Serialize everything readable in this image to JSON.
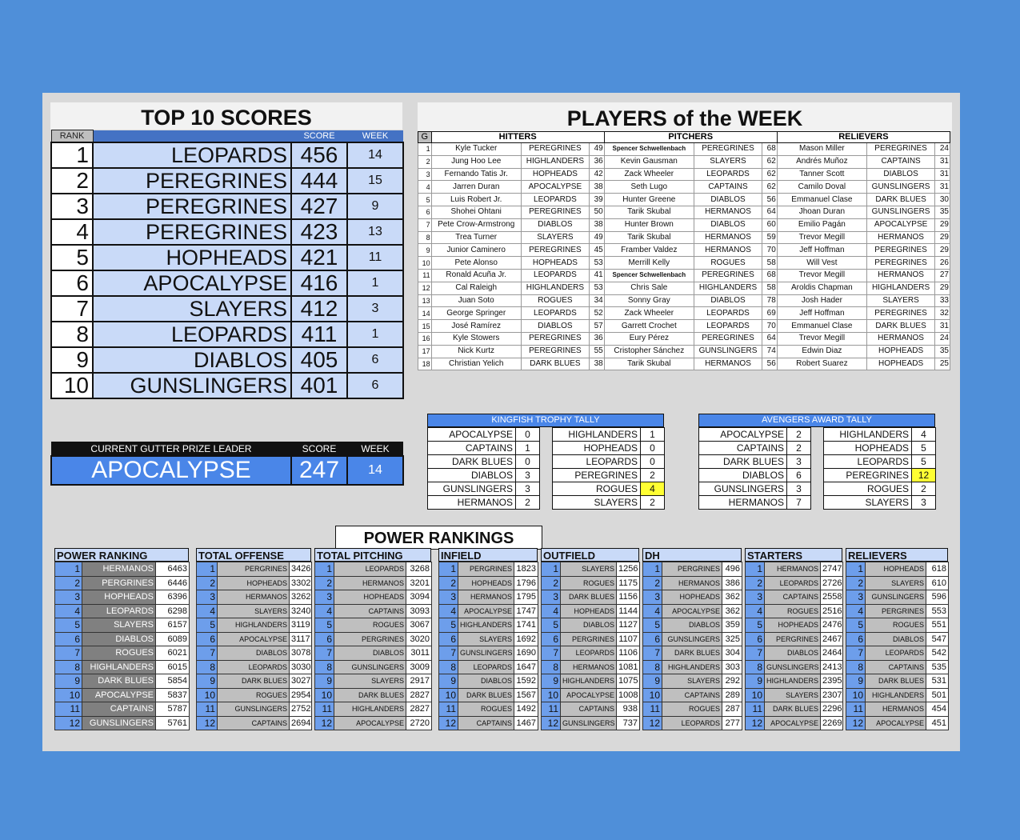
{
  "top10": {
    "title": "TOP 10 SCORES",
    "headers": {
      "rank": "RANK",
      "score": "SCORE",
      "week": "WEEK"
    },
    "rows": [
      {
        "rank": "1",
        "team": "LEOPARDS",
        "score": "456",
        "week": "14"
      },
      {
        "rank": "2",
        "team": "PEREGRINES",
        "score": "444",
        "week": "15"
      },
      {
        "rank": "3",
        "team": "PEREGRINES",
        "score": "427",
        "week": "9"
      },
      {
        "rank": "4",
        "team": "PEREGRINES",
        "score": "423",
        "week": "13"
      },
      {
        "rank": "5",
        "team": "HOPHEADS",
        "score": "421",
        "week": "11"
      },
      {
        "rank": "6",
        "team": "APOCALYPSE",
        "score": "416",
        "week": "1"
      },
      {
        "rank": "7",
        "team": "SLAYERS",
        "score": "412",
        "week": "3"
      },
      {
        "rank": "8",
        "team": "LEOPARDS",
        "score": "411",
        "week": "1"
      },
      {
        "rank": "9",
        "team": "DIABLOS",
        "score": "405",
        "week": "6"
      },
      {
        "rank": "10",
        "team": "GUNSLINGERS",
        "score": "401",
        "week": "6"
      }
    ]
  },
  "gutter": {
    "header": "CURRENT GUTTER PRIZE LEADER",
    "score_header": "SCORE",
    "week_header": "WEEK",
    "team": "APOCALYPSE",
    "score": "247",
    "week": "14"
  },
  "potw": {
    "title": "PLAYERS of the WEEK",
    "headers": {
      "g": "G",
      "hitters": "HITTERS",
      "pitchers": "PITCHERS",
      "relievers": "RELIEVERS"
    },
    "rows": [
      {
        "g": "1",
        "h": "Kyle Tucker",
        "ht": "PEREGRINES",
        "hs": "49",
        "p": "Spencer Schwellenbach",
        "pt": "PEREGRINES",
        "ps": "68",
        "r": "Mason Miller",
        "rt": "PEREGRINES",
        "rs": "24"
      },
      {
        "g": "2",
        "h": "Jung Hoo Lee",
        "ht": "HIGHLANDERS",
        "hs": "36",
        "p": "Kevin Gausman",
        "pt": "SLAYERS",
        "ps": "62",
        "r": "Andrés Muñoz",
        "rt": "CAPTAINS",
        "rs": "31"
      },
      {
        "g": "3",
        "h": "Fernando Tatis Jr.",
        "ht": "HOPHEADS",
        "hs": "42",
        "p": "Zack Wheeler",
        "pt": "LEOPARDS",
        "ps": "62",
        "r": "Tanner Scott",
        "rt": "DIABLOS",
        "rs": "31"
      },
      {
        "g": "4",
        "h": "Jarren Duran",
        "ht": "APOCALYPSE",
        "hs": "38",
        "p": "Seth Lugo",
        "pt": "CAPTAINS",
        "ps": "62",
        "r": "Camilo Doval",
        "rt": "GUNSLINGERS",
        "rs": "31"
      },
      {
        "g": "5",
        "h": "Luis Robert Jr.",
        "ht": "LEOPARDS",
        "hs": "39",
        "p": "Hunter Greene",
        "pt": "DIABLOS",
        "ps": "56",
        "r": "Emmanuel Clase",
        "rt": "DARK BLUES",
        "rs": "30"
      },
      {
        "g": "6",
        "h": "Shohei Ohtani",
        "ht": "PEREGRINES",
        "hs": "50",
        "p": "Tarik Skubal",
        "pt": "HERMANOS",
        "ps": "64",
        "r": "Jhoan Duran",
        "rt": "GUNSLINGERS",
        "rs": "35"
      },
      {
        "g": "7",
        "h": "Pete Crow-Armstrong",
        "ht": "DIABLOS",
        "hs": "38",
        "p": "Hunter Brown",
        "pt": "DIABLOS",
        "ps": "60",
        "r": "Emilio Pagán",
        "rt": "APOCALYPSE",
        "rs": "29"
      },
      {
        "g": "8",
        "h": "Trea Turner",
        "ht": "SLAYERS",
        "hs": "49",
        "p": "Tarik Skubal",
        "pt": "HERMANOS",
        "ps": "59",
        "r": "Trevor Megill",
        "rt": "HERMANOS",
        "rs": "29"
      },
      {
        "g": "9",
        "h": "Junior Caminero",
        "ht": "PEREGRINES",
        "hs": "45",
        "p": "Framber Valdez",
        "pt": "HERMANOS",
        "ps": "70",
        "r": "Jeff Hoffman",
        "rt": "PEREGRINES",
        "rs": "29"
      },
      {
        "g": "10",
        "h": "Pete Alonso",
        "ht": "HOPHEADS",
        "hs": "53",
        "p": "Merrill Kelly",
        "pt": "ROGUES",
        "ps": "58",
        "r": "Will Vest",
        "rt": "PEREGRINES",
        "rs": "26"
      },
      {
        "g": "11",
        "h": "Ronald Acuña Jr.",
        "ht": "LEOPARDS",
        "hs": "41",
        "p": "Spencer Schwellenbach",
        "pt": "PEREGRINES",
        "ps": "68",
        "r": "Trevor Megill",
        "rt": "HERMANOS",
        "rs": "27"
      },
      {
        "g": "12",
        "h": "Cal Raleigh",
        "ht": "HIGHLANDERS",
        "hs": "53",
        "p": "Chris Sale",
        "pt": "HIGHLANDERS",
        "ps": "58",
        "r": "Aroldis Chapman",
        "rt": "HIGHLANDERS",
        "rs": "29"
      },
      {
        "g": "13",
        "h": "Juan Soto",
        "ht": "ROGUES",
        "hs": "34",
        "p": "Sonny Gray",
        "pt": "DIABLOS",
        "ps": "78",
        "r": "Josh Hader",
        "rt": "SLAYERS",
        "rs": "33"
      },
      {
        "g": "14",
        "h": "George Springer",
        "ht": "LEOPARDS",
        "hs": "52",
        "p": "Zack Wheeler",
        "pt": "LEOPARDS",
        "ps": "69",
        "r": "Jeff Hoffman",
        "rt": "PEREGRINES",
        "rs": "32"
      },
      {
        "g": "15",
        "h": "José Ramírez",
        "ht": "DIABLOS",
        "hs": "57",
        "p": "Garrett Crochet",
        "pt": "LEOPARDS",
        "ps": "70",
        "r": "Emmanuel Clase",
        "rt": "DARK BLUES",
        "rs": "31"
      },
      {
        "g": "16",
        "h": "Kyle Stowers",
        "ht": "PEREGRINES",
        "hs": "36",
        "p": "Eury Pérez",
        "pt": "PEREGRINES",
        "ps": "64",
        "r": "Trevor Megill",
        "rt": "HERMANOS",
        "rs": "24"
      },
      {
        "g": "17",
        "h": "Nick Kurtz",
        "ht": "PEREGRINES",
        "hs": "55",
        "p": "Cristopher Sánchez",
        "pt": "GUNSLINGERS",
        "ps": "74",
        "r": "Edwin Diaz",
        "rt": "HOPHEADS",
        "rs": "35"
      },
      {
        "g": "18",
        "h": "Christian Yelich",
        "ht": "DARK BLUES",
        "hs": "38",
        "p": "Tarik Skubal",
        "pt": "HERMANOS",
        "ps": "56",
        "r": "Robert Suarez",
        "rt": "HOPHEADS",
        "rs": "25"
      }
    ]
  },
  "kingfish": {
    "title": "KINGFISH TROPHY TALLY",
    "left": [
      {
        "team": "APOCALYPSE",
        "v": "0"
      },
      {
        "team": "CAPTAINS",
        "v": "1"
      },
      {
        "team": "DARK BLUES",
        "v": "0"
      },
      {
        "team": "DIABLOS",
        "v": "3"
      },
      {
        "team": "GUNSLINGERS",
        "v": "3"
      },
      {
        "team": "HERMANOS",
        "v": "2"
      }
    ],
    "right": [
      {
        "team": "HIGHLANDERS",
        "v": "1"
      },
      {
        "team": "HOPHEADS",
        "v": "0"
      },
      {
        "team": "LEOPARDS",
        "v": "0"
      },
      {
        "team": "PEREGRINES",
        "v": "2"
      },
      {
        "team": "ROGUES",
        "v": "4",
        "hi": true
      },
      {
        "team": "SLAYERS",
        "v": "2"
      }
    ]
  },
  "avengers": {
    "title": "AVENGERS AWARD TALLY",
    "left": [
      {
        "team": "APOCALYPSE",
        "v": "2"
      },
      {
        "team": "CAPTAINS",
        "v": "2"
      },
      {
        "team": "DARK BLUES",
        "v": "3"
      },
      {
        "team": "DIABLOS",
        "v": "6"
      },
      {
        "team": "GUNSLINGERS",
        "v": "3"
      },
      {
        "team": "HERMANOS",
        "v": "7"
      }
    ],
    "right": [
      {
        "team": "HIGHLANDERS",
        "v": "4"
      },
      {
        "team": "HOPHEADS",
        "v": "5"
      },
      {
        "team": "LEOPARDS",
        "v": "5"
      },
      {
        "team": "PEREGRINES",
        "v": "12",
        "hi": true
      },
      {
        "team": "ROGUES",
        "v": "2"
      },
      {
        "team": "SLAYERS",
        "v": "3"
      }
    ]
  },
  "power": {
    "title": "POWER RANKINGS",
    "tables": [
      {
        "header": "POWER RANKING",
        "rows": [
          [
            "1",
            "HERMANOS",
            "6463"
          ],
          [
            "2",
            "PERGRINES",
            "6446"
          ],
          [
            "3",
            "HOPHEADS",
            "6396"
          ],
          [
            "4",
            "LEOPARDS",
            "6298"
          ],
          [
            "5",
            "SLAYERS",
            "6157"
          ],
          [
            "6",
            "DIABLOS",
            "6089"
          ],
          [
            "7",
            "ROGUES",
            "6021"
          ],
          [
            "8",
            "HIGHLANDERS",
            "6015"
          ],
          [
            "9",
            "DARK BLUES",
            "5854"
          ],
          [
            "10",
            "APOCALYPSE",
            "5837"
          ],
          [
            "11",
            "CAPTAINS",
            "5787"
          ],
          [
            "12",
            "GUNSLINGERS",
            "5761"
          ]
        ]
      },
      {
        "header": "TOTAL OFFENSE",
        "rows": [
          [
            "1",
            "PERGRINES",
            "3426"
          ],
          [
            "2",
            "HOPHEADS",
            "3302"
          ],
          [
            "3",
            "HERMANOS",
            "3262"
          ],
          [
            "4",
            "SLAYERS",
            "3240"
          ],
          [
            "5",
            "HIGHLANDERS",
            "3119"
          ],
          [
            "6",
            "APOCALYPSE",
            "3117"
          ],
          [
            "7",
            "DIABLOS",
            "3078"
          ],
          [
            "8",
            "LEOPARDS",
            "3030"
          ],
          [
            "9",
            "DARK BLUES",
            "3027"
          ],
          [
            "10",
            "ROGUES",
            "2954"
          ],
          [
            "11",
            "GUNSLINGERS",
            "2752"
          ],
          [
            "12",
            "CAPTAINS",
            "2694"
          ]
        ]
      },
      {
        "header": "TOTAL PITCHING",
        "rows": [
          [
            "1",
            "LEOPARDS",
            "3268"
          ],
          [
            "2",
            "HERMANOS",
            "3201"
          ],
          [
            "3",
            "HOPHEADS",
            "3094"
          ],
          [
            "4",
            "CAPTAINS",
            "3093"
          ],
          [
            "5",
            "ROGUES",
            "3067"
          ],
          [
            "6",
            "PERGRINES",
            "3020"
          ],
          [
            "7",
            "DIABLOS",
            "3011"
          ],
          [
            "8",
            "GUNSLINGERS",
            "3009"
          ],
          [
            "9",
            "SLAYERS",
            "2917"
          ],
          [
            "10",
            "DARK BLUES",
            "2827"
          ],
          [
            "11",
            "HIGHLANDERS",
            "2827"
          ],
          [
            "12",
            "APOCALYPSE",
            "2720"
          ]
        ]
      },
      {
        "header": "INFIELD",
        "rows": [
          [
            "1",
            "PERGRINES",
            "1823"
          ],
          [
            "2",
            "HOPHEADS",
            "1796"
          ],
          [
            "3",
            "HERMANOS",
            "1795"
          ],
          [
            "4",
            "APOCALYPSE",
            "1747"
          ],
          [
            "5",
            "HIGHLANDERS",
            "1741"
          ],
          [
            "6",
            "SLAYERS",
            "1692"
          ],
          [
            "7",
            "GUNSLINGERS",
            "1690"
          ],
          [
            "8",
            "LEOPARDS",
            "1647"
          ],
          [
            "9",
            "DIABLOS",
            "1592"
          ],
          [
            "10",
            "DARK BLUES",
            "1567"
          ],
          [
            "11",
            "ROGUES",
            "1492"
          ],
          [
            "12",
            "CAPTAINS",
            "1467"
          ]
        ]
      },
      {
        "header": "OUTFIELD",
        "rows": [
          [
            "1",
            "SLAYERS",
            "1256"
          ],
          [
            "2",
            "ROGUES",
            "1175"
          ],
          [
            "3",
            "DARK BLUES",
            "1156"
          ],
          [
            "4",
            "HOPHEADS",
            "1144"
          ],
          [
            "5",
            "DIABLOS",
            "1127"
          ],
          [
            "6",
            "PERGRINES",
            "1107"
          ],
          [
            "7",
            "LEOPARDS",
            "1106"
          ],
          [
            "8",
            "HERMANOS",
            "1081"
          ],
          [
            "9",
            "HIGHLANDERS",
            "1075"
          ],
          [
            "10",
            "APOCALYPSE",
            "1008"
          ],
          [
            "11",
            "CAPTAINS",
            "938"
          ],
          [
            "12",
            "GUNSLINGERS",
            "737"
          ]
        ]
      },
      {
        "header": "DH",
        "rows": [
          [
            "1",
            "PERGRINES",
            "496"
          ],
          [
            "2",
            "HERMANOS",
            "386"
          ],
          [
            "3",
            "HOPHEADS",
            "362"
          ],
          [
            "4",
            "APOCALYPSE",
            "362"
          ],
          [
            "5",
            "DIABLOS",
            "359"
          ],
          [
            "6",
            "GUNSLINGERS",
            "325"
          ],
          [
            "7",
            "DARK BLUES",
            "304"
          ],
          [
            "8",
            "HIGHLANDERS",
            "303"
          ],
          [
            "9",
            "SLAYERS",
            "292"
          ],
          [
            "10",
            "CAPTAINS",
            "289"
          ],
          [
            "11",
            "ROGUES",
            "287"
          ],
          [
            "12",
            "LEOPARDS",
            "277"
          ]
        ]
      },
      {
        "header": "STARTERS",
        "rows": [
          [
            "1",
            "HERMANOS",
            "2747"
          ],
          [
            "2",
            "LEOPARDS",
            "2726"
          ],
          [
            "3",
            "CAPTAINS",
            "2558"
          ],
          [
            "4",
            "ROGUES",
            "2516"
          ],
          [
            "5",
            "HOPHEADS",
            "2476"
          ],
          [
            "6",
            "PERGRINES",
            "2467"
          ],
          [
            "7",
            "DIABLOS",
            "2464"
          ],
          [
            "8",
            "GUNSLINGERS",
            "2413"
          ],
          [
            "9",
            "HIGHLANDERS",
            "2395"
          ],
          [
            "10",
            "SLAYERS",
            "2307"
          ],
          [
            "11",
            "DARK BLUES",
            "2296"
          ],
          [
            "12",
            "APOCALYPSE",
            "2269"
          ]
        ]
      },
      {
        "header": "RELIEVERS",
        "rows": [
          [
            "1",
            "HOPHEADS",
            "618"
          ],
          [
            "2",
            "SLAYERS",
            "610"
          ],
          [
            "3",
            "GUNSLINGERS",
            "596"
          ],
          [
            "4",
            "PERGRINES",
            "553"
          ],
          [
            "5",
            "ROGUES",
            "551"
          ],
          [
            "6",
            "DIABLOS",
            "547"
          ],
          [
            "7",
            "LEOPARDS",
            "542"
          ],
          [
            "8",
            "CAPTAINS",
            "535"
          ],
          [
            "9",
            "DARK BLUES",
            "531"
          ],
          [
            "10",
            "HIGHLANDERS",
            "501"
          ],
          [
            "11",
            "HERMANOS",
            "454"
          ],
          [
            "12",
            "APOCALYPSE",
            "451"
          ]
        ]
      }
    ]
  }
}
